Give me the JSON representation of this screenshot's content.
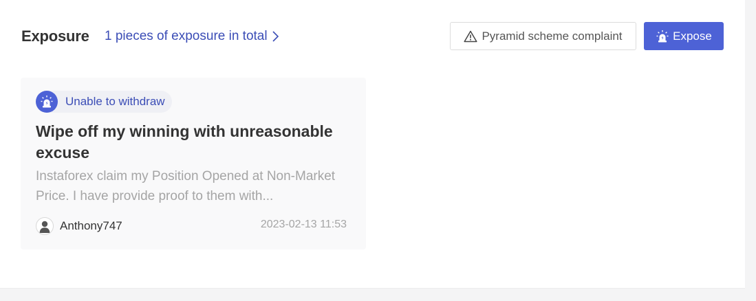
{
  "header": {
    "title": "Exposure",
    "total_link": "1 pieces of exposure in total",
    "complaint_button": "Pyramid scheme complaint",
    "expose_button": "Expose"
  },
  "icons": {
    "total_link": "chevron-right-icon",
    "complaint_button": "warning-triangle-icon",
    "expose_button": "alarm-siren-icon",
    "tag": "alarm-siren-icon",
    "avatar": "user-avatar-icon"
  },
  "colors": {
    "accent": "#4d62d6",
    "link": "#3b4db6",
    "card_background": "#f9f9fa",
    "muted_text": "#a5a5a5"
  },
  "exposures": [
    {
      "tag": "Unable to withdraw",
      "title": "Wipe off my winning with unreasonable excuse",
      "excerpt": "Instaforex claim my Position Opened at Non-Market Price. I have provide proof to them with...",
      "author": "Anthony747",
      "time": "2023-02-13 11:53"
    }
  ]
}
